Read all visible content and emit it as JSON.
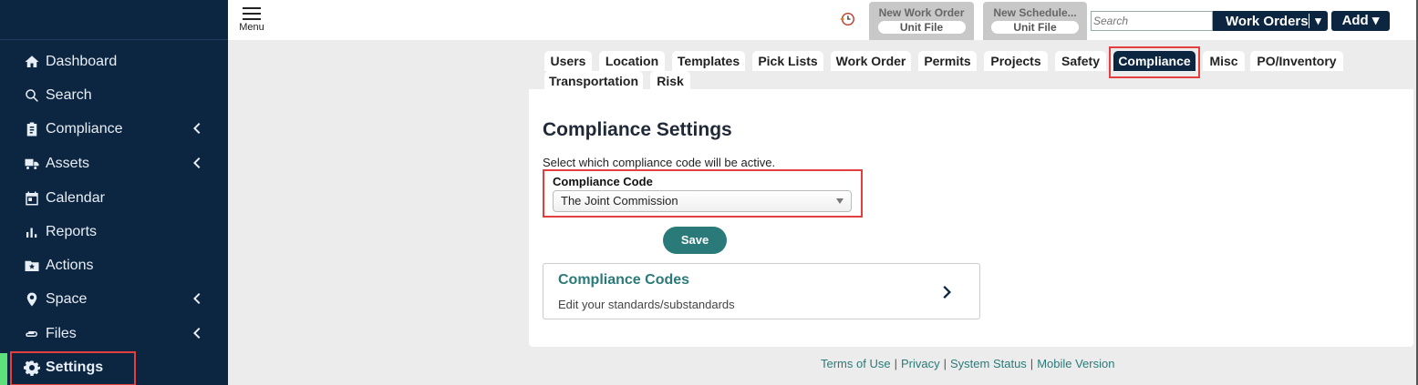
{
  "header": {
    "menu_label": "Menu",
    "quick_buttons": [
      {
        "title": "New Work Order",
        "sub": "Unit File"
      },
      {
        "title": "New Schedule...",
        "sub": "Unit File"
      }
    ],
    "search_placeholder": "Search",
    "work_orders_label": "Work Orders",
    "dropdown_glyph": "▾",
    "add_label": "Add ▾"
  },
  "sidebar": {
    "items": [
      {
        "label": "Dashboard",
        "icon": "home-icon"
      },
      {
        "label": "Search",
        "icon": "search-icon"
      },
      {
        "label": "Compliance",
        "icon": "clipboard-icon",
        "expandable": true
      },
      {
        "label": "Assets",
        "icon": "truck-icon",
        "expandable": true
      },
      {
        "label": "Calendar",
        "icon": "calendar-icon"
      },
      {
        "label": "Reports",
        "icon": "bar-chart-icon"
      },
      {
        "label": "Actions",
        "icon": "folder-star-icon"
      },
      {
        "label": "Space",
        "icon": "location-pin-icon",
        "expandable": true
      },
      {
        "label": "Files",
        "icon": "paperclip-icon",
        "expandable": true
      },
      {
        "label": "Settings",
        "icon": "gear-icon",
        "active": true
      }
    ]
  },
  "tabs": [
    {
      "label": "Users"
    },
    {
      "label": "Location"
    },
    {
      "label": "Templates"
    },
    {
      "label": "Pick Lists"
    },
    {
      "label": "Work Order"
    },
    {
      "label": "Permits"
    },
    {
      "label": "Projects"
    },
    {
      "label": "Safety"
    },
    {
      "label": "Compliance",
      "active": true
    },
    {
      "label": "Misc"
    },
    {
      "label": "PO/Inventory"
    },
    {
      "label": "Transportation"
    },
    {
      "label": "Risk"
    }
  ],
  "main": {
    "title": "Compliance Settings",
    "instructions": "Select which compliance code will be active.",
    "field_label": "Compliance Code",
    "selected_value": "The Joint Commission",
    "save_label": "Save",
    "card": {
      "title": "Compliance Codes",
      "description": "Edit your standards/substandards"
    }
  },
  "footer": {
    "links": [
      "Terms of Use",
      "Privacy",
      "System Status",
      "Mobile Version"
    ],
    "separator": "|"
  },
  "colors": {
    "sidebar_bg": "#0c2541",
    "accent_teal": "#2b7a7a",
    "highlight_red": "#e53e3e",
    "active_marker": "#5ee07a"
  }
}
